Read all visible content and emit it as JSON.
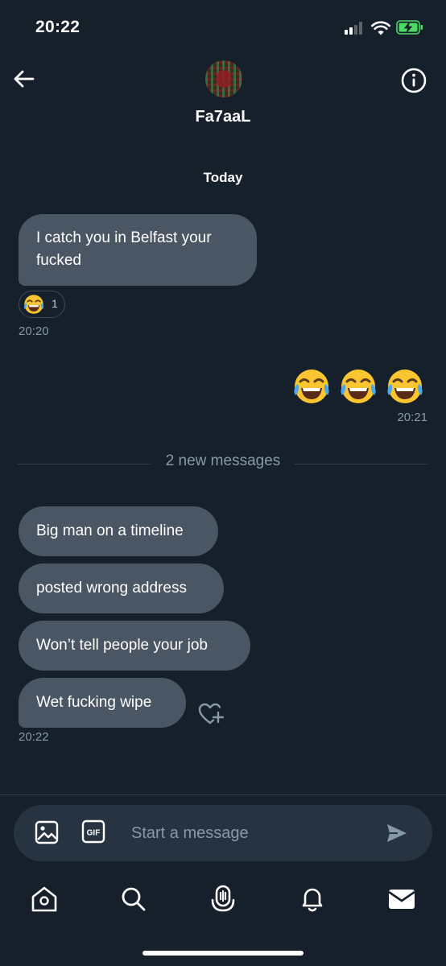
{
  "status_bar": {
    "time": "20:22"
  },
  "header": {
    "contact_name": "Fa7aaL",
    "back_icon": "arrow-left-icon",
    "info_icon": "info-circle-icon"
  },
  "conversation": {
    "day_label": "Today",
    "incoming_first": {
      "text": "I catch you in Belfast your fucked",
      "reaction_emoji": "face-with-tears-of-joy",
      "reaction_count": "1",
      "timestamp": "20:20"
    },
    "outgoing": {
      "emojis": [
        "😂",
        "😂",
        "😂"
      ],
      "timestamp": "20:21"
    },
    "new_messages_divider": "2 new messages",
    "incoming_group": {
      "messages": [
        "Big man on a timeline",
        "posted wrong address",
        "Won’t tell people your job",
        "Wet fucking wipe"
      ],
      "timestamp": "20:22"
    }
  },
  "composer": {
    "placeholder": "Start a message",
    "media_icon": "image-icon",
    "gif_icon": "gif-icon",
    "send_icon": "send-icon"
  },
  "bottom_nav": {
    "items": [
      "home-icon",
      "search-icon",
      "spaces-icon",
      "notifications-icon",
      "messages-icon"
    ]
  },
  "colors": {
    "background": "#15202b",
    "bubble": "#4a5663",
    "muted_text": "#8899a6",
    "composer": "#273340",
    "battery_green": "#4cd964"
  }
}
